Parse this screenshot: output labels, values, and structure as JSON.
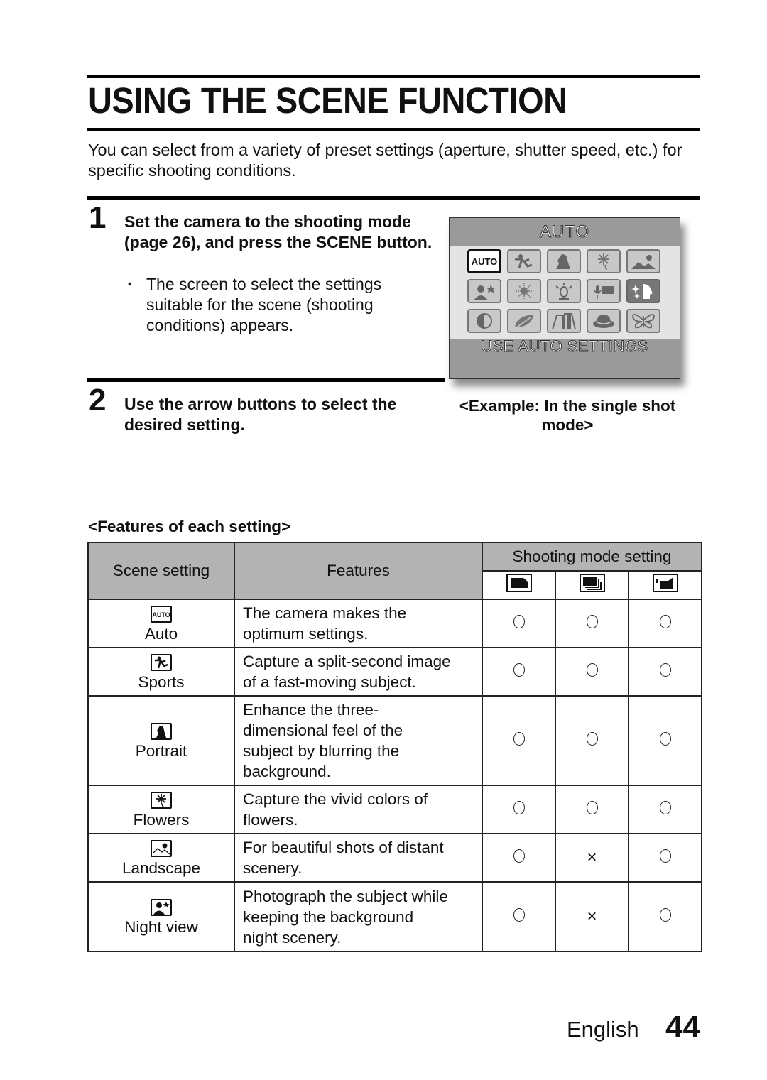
{
  "page": {
    "title": "USING THE SCENE FUNCTION",
    "intro": "You can select from a variety of preset settings (aperture, shutter speed, etc.) for specific shooting conditions."
  },
  "steps": [
    {
      "number": "1",
      "heading": "Set the camera to the shooting mode (page 26), and press the SCENE button.",
      "bullet": "The screen to select the settings suitable for the scene (shooting conditions) appears."
    },
    {
      "number": "2",
      "heading": "Use the arrow buttons to select the desired setting."
    }
  ],
  "lcd": {
    "title": "AUTO",
    "footer": "USE AUTO SETTINGS",
    "selected_label": "AUTO",
    "icons": [
      [
        "auto-icon",
        "sports-icon",
        "portrait-icon",
        "flowers-icon",
        "landscape-icon"
      ],
      [
        "night-view-icon",
        "fireworks-icon",
        "lamp-icon",
        "voice-memo-icon",
        "sparkle-face-icon"
      ],
      [
        "contrast-icon",
        "leaf-icon",
        "buildings-icon",
        "hat-icon",
        "butterfly-icon"
      ]
    ],
    "caption": "<Example: In the single shot mode>"
  },
  "features": {
    "label": "<Features of each setting>",
    "headers": {
      "scene": "Scene setting",
      "features": "Features",
      "shooting_mode": "Shooting mode setting",
      "modes": [
        "single-shot-icon",
        "sequential-shot-icon",
        "video-icon"
      ]
    },
    "rows": [
      {
        "icon": "auto-icon",
        "scene": "Auto",
        "features": [
          "The camera makes the",
          "optimum settings."
        ],
        "marks": [
          "○",
          "○",
          "○"
        ]
      },
      {
        "icon": "sports-icon",
        "scene": "Sports",
        "features": [
          "Capture a split-second image",
          "of a fast-moving subject."
        ],
        "marks": [
          "○",
          "○",
          "○"
        ]
      },
      {
        "icon": "portrait-icon",
        "scene": "Portrait",
        "features": [
          "Enhance the three-",
          "dimensional feel of the",
          "subject by blurring the",
          "background."
        ],
        "marks": [
          "○",
          "○",
          "○"
        ]
      },
      {
        "icon": "flowers-icon",
        "scene": "Flowers",
        "features": [
          "Capture the vivid colors of",
          "flowers."
        ],
        "marks": [
          "○",
          "○",
          "○"
        ]
      },
      {
        "icon": "landscape-icon",
        "scene": "Landscape",
        "features": [
          "For beautiful shots of distant",
          "scenery."
        ],
        "marks": [
          "○",
          "×",
          "○"
        ]
      },
      {
        "icon": "night-view-icon",
        "scene": "Night view",
        "features": [
          "Photograph the subject while",
          "keeping the background",
          "night scenery."
        ],
        "marks": [
          "○",
          "×",
          "○"
        ]
      }
    ]
  },
  "footer": {
    "language": "English",
    "page_number": "44"
  }
}
